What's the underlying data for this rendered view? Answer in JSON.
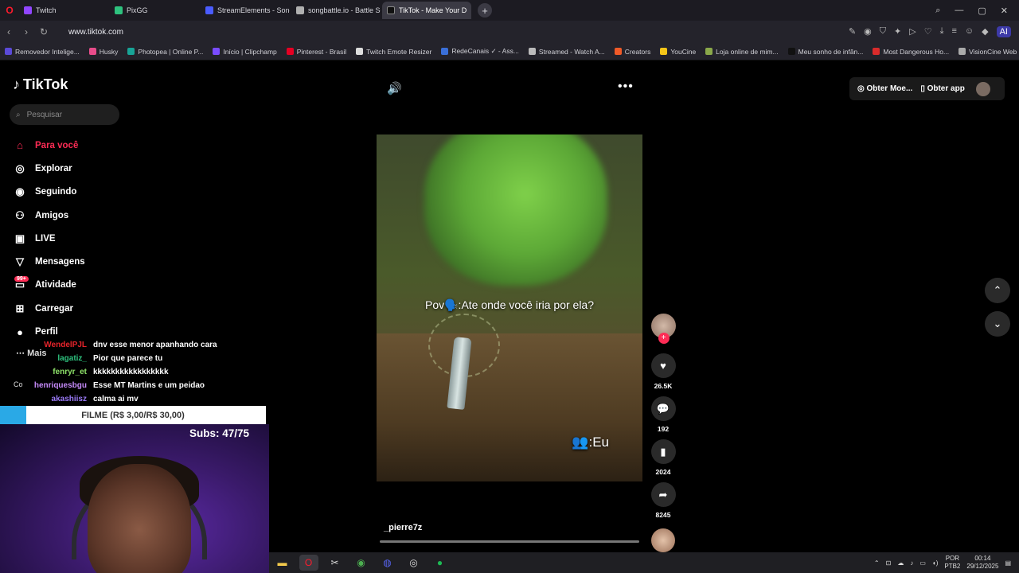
{
  "browser": {
    "tabs": [
      {
        "label": "Twitch",
        "color": "#9146ff"
      },
      {
        "label": "PixGG",
        "color": "#2ec27e"
      },
      {
        "label": "StreamElements - Songre",
        "color": "#4a5cff"
      },
      {
        "label": "songbattle.io - Battle Son",
        "color": "#b0b0b0"
      },
      {
        "label": "TikTok - Make Your D",
        "color": "#111111"
      }
    ],
    "url": "www.tiktok.com",
    "bookmarks": [
      {
        "label": "Removedor Intelige...",
        "color": "#5b4ad8"
      },
      {
        "label": "Husky",
        "color": "#e84c8a"
      },
      {
        "label": "Photopea | Online P...",
        "color": "#18a497"
      },
      {
        "label": "Início | Clipchamp",
        "color": "#7a4cff"
      },
      {
        "label": "Pinterest - Brasil",
        "color": "#e60023"
      },
      {
        "label": "Twitch Emote Resizer",
        "color": "#dddddd"
      },
      {
        "label": "RedeCanais ✓ - Ass...",
        "color": "#3a6fd8"
      },
      {
        "label": "Streamed - Watch A...",
        "color": "#bbbbbb"
      },
      {
        "label": "Creators",
        "color": "#f05a28"
      },
      {
        "label": "YouCine",
        "color": "#f5c518"
      },
      {
        "label": "Loja online de mim...",
        "color": "#8aa84a"
      },
      {
        "label": "Meu sonho de infân...",
        "color": "#111111"
      },
      {
        "label": "Most Dangerous Ho...",
        "color": "#d92b2b"
      },
      {
        "label": "VisionCine Web - Fil...",
        "color": "#aaaaaa"
      }
    ],
    "ai_label": "AI"
  },
  "tiktok": {
    "logo_text": "TikTok",
    "search_placeholder": "Pesquisar",
    "nav": [
      {
        "label": "Para você",
        "icon": "home-icon",
        "active": true
      },
      {
        "label": "Explorar",
        "icon": "compass-icon"
      },
      {
        "label": "Seguindo",
        "icon": "following-icon"
      },
      {
        "label": "Amigos",
        "icon": "friends-icon"
      },
      {
        "label": "LIVE",
        "icon": "live-icon"
      },
      {
        "label": "Mensagens",
        "icon": "messages-icon"
      },
      {
        "label": "Atividade",
        "icon": "activity-icon",
        "badge": "99+"
      },
      {
        "label": "Carregar",
        "icon": "upload-icon"
      },
      {
        "label": "Perfil",
        "icon": "profile-icon"
      }
    ],
    "mais": "Mais",
    "header": {
      "coins": "Obter Moe...",
      "app": "Obter app"
    },
    "video": {
      "caption_top": "Pov🗣️:Ate onde você iria por ela?",
      "caption_bottom": "👥:Eu",
      "author": "_pierre7z"
    },
    "actions": {
      "likes": "26.5K",
      "comments": "192",
      "saves": "2024",
      "shares": "8245"
    }
  },
  "stream_overlay": {
    "chat": [
      {
        "user": "WendelPJL",
        "color": "#e8242b",
        "message": "dnv esse menor apanhando cara"
      },
      {
        "user": "lagatiz_",
        "color": "#2ec27e",
        "message": "Pior que parece tu"
      },
      {
        "user": "fenryr_et",
        "color": "#8fe36a",
        "message": "kkkkkkkkkkkkkkkkk"
      },
      {
        "user": "henriquesbgu",
        "color": "#c58af9",
        "message": "Esse MT Martins e um peidao"
      },
      {
        "user": "akashiisz",
        "color": "#9b7af8",
        "message": "calma ai mv"
      }
    ],
    "cmais_text": "Co",
    "goal_label": "FILME (R$ 3,00/R$ 30,00)",
    "subs_label": "Subs: 47/75"
  },
  "taskbar": {
    "lang": "POR",
    "layout": "PTB2",
    "time": "00:14",
    "date": "29/12/2025"
  }
}
